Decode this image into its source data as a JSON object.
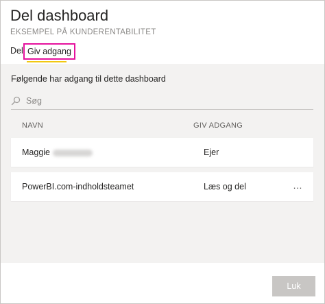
{
  "dialog": {
    "title": "Del dashboard",
    "subtitle": "EKSEMPEL PÅ KUNDERENTABILITET",
    "tabs": [
      {
        "label": "Del"
      },
      {
        "label": "Giv adgang"
      }
    ],
    "active_tab_underline_color": "#f2c811",
    "highlight_color": "#e5119d"
  },
  "access": {
    "heading": "Følgende har adgang til dette dashboard",
    "search": {
      "placeholder": "Søg",
      "value": "",
      "icon": "search-icon"
    },
    "columns": {
      "name": "NAVN",
      "access": "GIV ADGANG"
    },
    "rows": [
      {
        "name": "Maggie",
        "access": "Ejer"
      },
      {
        "name": "PowerBI.com-indholdsteamet",
        "access": "Læs og del",
        "more_icon": "…"
      }
    ]
  },
  "footer": {
    "close_label": "Luk"
  }
}
